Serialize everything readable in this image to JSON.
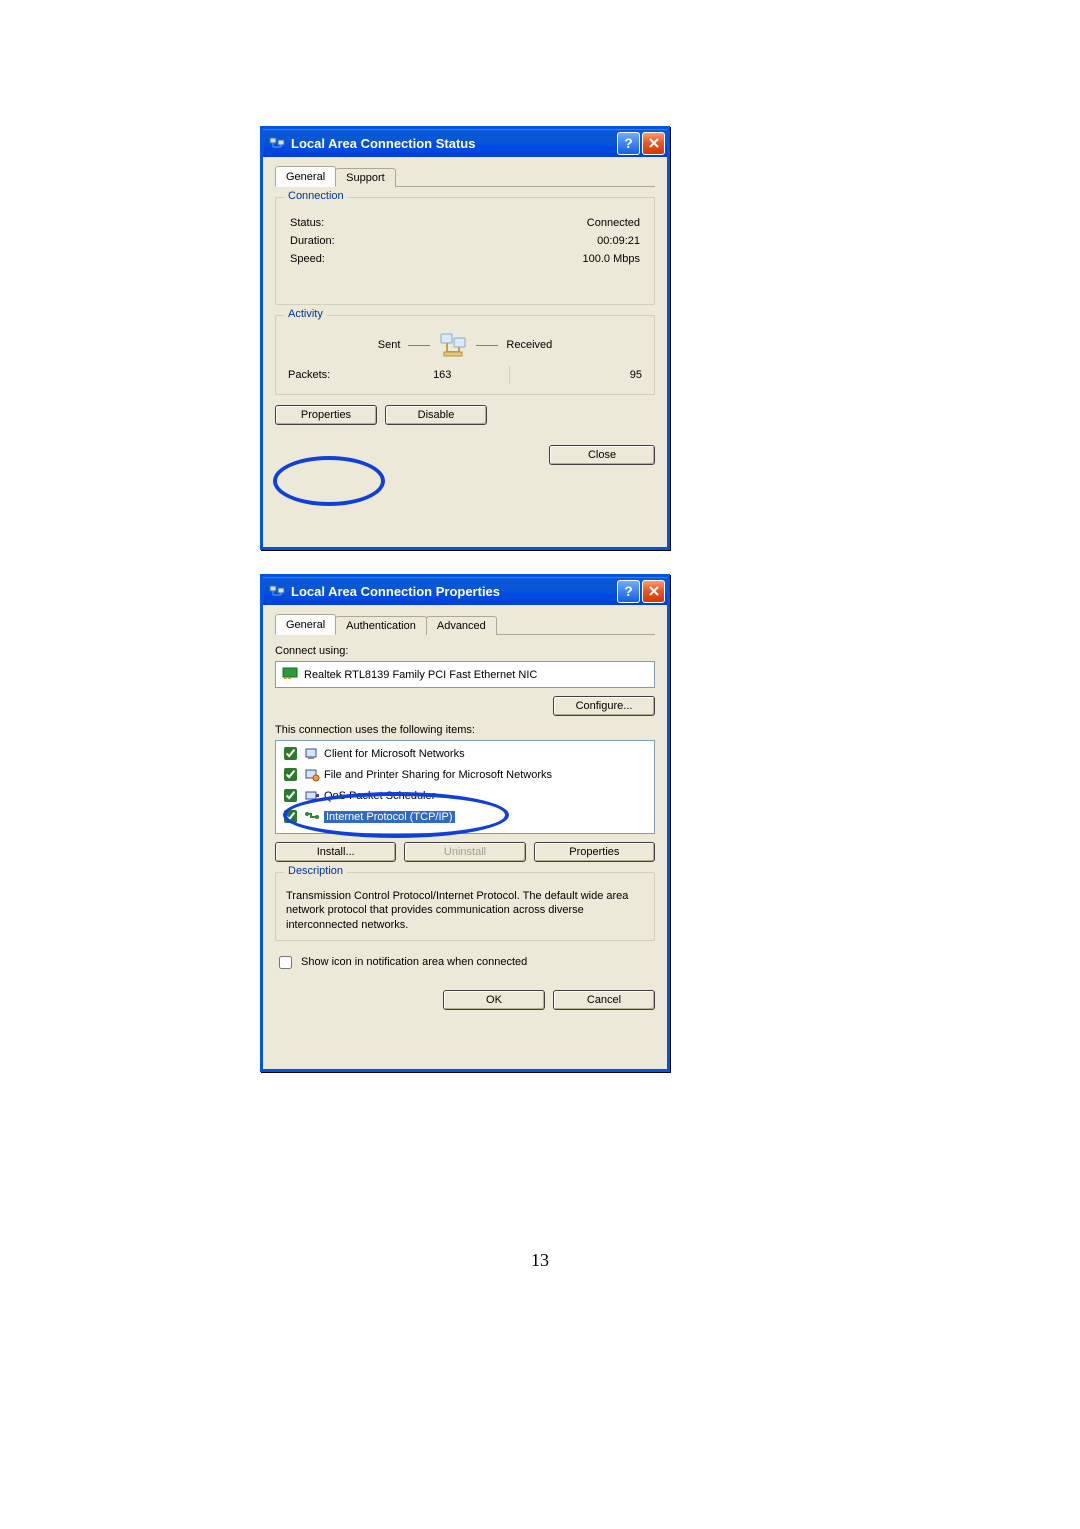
{
  "page_number": "13",
  "status_dialog": {
    "title": "Local Area Connection Status",
    "tabs": {
      "general": "General",
      "support": "Support"
    },
    "connection": {
      "heading": "Connection",
      "status_label": "Status:",
      "status_value": "Connected",
      "duration_label": "Duration:",
      "duration_value": "00:09:21",
      "speed_label": "Speed:",
      "speed_value": "100.0 Mbps"
    },
    "activity": {
      "heading": "Activity",
      "sent_label": "Sent",
      "received_label": "Received",
      "packets_label": "Packets:",
      "packets_sent": "163",
      "packets_received": "95"
    },
    "buttons": {
      "properties": "Properties",
      "disable": "Disable",
      "close": "Close"
    }
  },
  "props_dialog": {
    "title": "Local Area Connection Properties",
    "tabs": {
      "general": "General",
      "authentication": "Authentication",
      "advanced": "Advanced"
    },
    "connect_using_label": "Connect using:",
    "adapter": "Realtek RTL8139 Family PCI Fast Ethernet NIC",
    "configure_btn": "Configure...",
    "items_label": "This connection uses the following items:",
    "items": [
      {
        "label": "Client for Microsoft Networks",
        "checked": true
      },
      {
        "label": "File and Printer Sharing for Microsoft Networks",
        "checked": true
      },
      {
        "label": "QoS Packet Scheduler",
        "checked": true
      },
      {
        "label": "Internet Protocol (TCP/IP)",
        "checked": true,
        "selected": true
      }
    ],
    "install_btn": "Install...",
    "uninstall_btn": "Uninstall",
    "properties_btn": "Properties",
    "description_heading": "Description",
    "description_text": "Transmission Control Protocol/Internet Protocol. The default wide area network protocol that provides communication across diverse interconnected networks.",
    "show_icon_label": "Show icon in notification area when connected",
    "ok_btn": "OK",
    "cancel_btn": "Cancel"
  }
}
